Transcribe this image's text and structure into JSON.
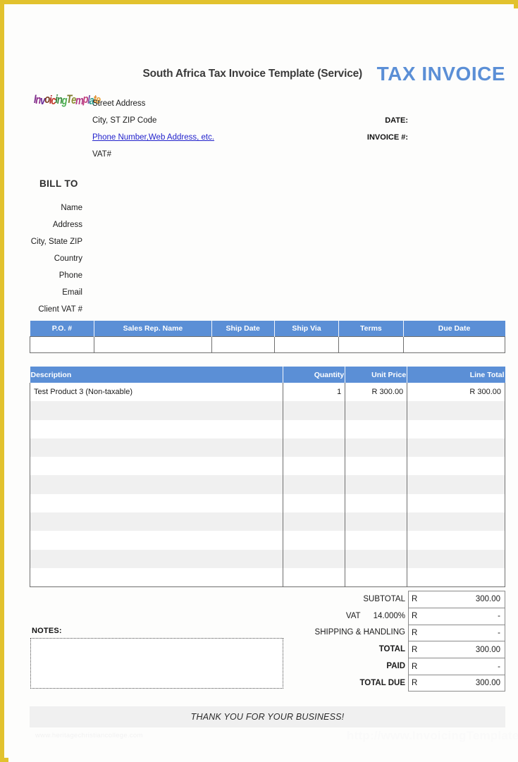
{
  "page": {
    "border_color": "#e2c22e",
    "accent_color": "#5b8fd6",
    "title": "South Africa Tax Invoice Template (Service)",
    "doc_type": "TAX INVOICE"
  },
  "logo": {
    "text": "InvoicingTemplate",
    "letters": [
      {
        "ch": "I",
        "color": "#7b2d8b"
      },
      {
        "ch": "n",
        "color": "#8e2d8b"
      },
      {
        "ch": "v",
        "color": "#6b2e9a"
      },
      {
        "ch": "o",
        "color": "#7a3d1f"
      },
      {
        "ch": "i",
        "color": "#b3262c"
      },
      {
        "ch": "c",
        "color": "#c43a2a"
      },
      {
        "ch": "i",
        "color": "#2e7d32"
      },
      {
        "ch": "n",
        "color": "#3c8c3f"
      },
      {
        "ch": "g",
        "color": "#4caf50"
      },
      {
        "ch": "T",
        "color": "#7e7a2e"
      },
      {
        "ch": "e",
        "color": "#8c8f33"
      },
      {
        "ch": "m",
        "color": "#b23a86"
      },
      {
        "ch": "p",
        "color": "#c2417f"
      },
      {
        "ch": "l",
        "color": "#7b4fa8"
      },
      {
        "ch": "a",
        "color": "#2f9e8f"
      },
      {
        "ch": "t",
        "color": "#e08b2a"
      },
      {
        "ch": "e",
        "color": "#e8a23a"
      }
    ]
  },
  "company": {
    "street": "Street Address",
    "city_line": "City, ST  ZIP Code",
    "contact_link": "Phone Number,Web Address, etc.",
    "vat": "VAT#"
  },
  "meta": {
    "date_label": "DATE:",
    "invoice_no_label": "INVOICE #:",
    "date_value": "",
    "invoice_no_value": ""
  },
  "bill_to": {
    "title": "BILL TO",
    "fields": [
      "Name",
      "Address",
      "City, State ZIP",
      "Country",
      "Phone",
      "Email",
      "Client VAT #"
    ]
  },
  "info_table": {
    "headers": [
      "P.O. #",
      "Sales Rep. Name",
      "Ship Date",
      "Ship Via",
      "Terms",
      "Due Date"
    ],
    "row": [
      "",
      "",
      "",
      "",
      "",
      ""
    ]
  },
  "items_table": {
    "headers": [
      "Description",
      "Quantity",
      "Unit Price",
      "Line Total"
    ],
    "rows": [
      {
        "description": "Test Product 3 (Non-taxable)",
        "quantity": "1",
        "unit_price": "R 300.00",
        "line_total": "R 300.00"
      },
      {
        "description": "",
        "quantity": "",
        "unit_price": "",
        "line_total": ""
      },
      {
        "description": "",
        "quantity": "",
        "unit_price": "",
        "line_total": ""
      },
      {
        "description": "",
        "quantity": "",
        "unit_price": "",
        "line_total": ""
      },
      {
        "description": "",
        "quantity": "",
        "unit_price": "",
        "line_total": ""
      },
      {
        "description": "",
        "quantity": "",
        "unit_price": "",
        "line_total": ""
      },
      {
        "description": "",
        "quantity": "",
        "unit_price": "",
        "line_total": ""
      },
      {
        "description": "",
        "quantity": "",
        "unit_price": "",
        "line_total": ""
      },
      {
        "description": "",
        "quantity": "",
        "unit_price": "",
        "line_total": ""
      },
      {
        "description": "",
        "quantity": "",
        "unit_price": "",
        "line_total": ""
      },
      {
        "description": "",
        "quantity": "",
        "unit_price": "",
        "line_total": ""
      }
    ]
  },
  "totals": {
    "currency": "R",
    "rows": [
      {
        "label": "SUBTOTAL",
        "rate": "",
        "amount": "300.00",
        "bold": false
      },
      {
        "label": "VAT",
        "rate": "14.000%",
        "amount": "-",
        "bold": false
      },
      {
        "label": "SHIPPING & HANDLING",
        "rate": "",
        "amount": "-",
        "bold": false
      },
      {
        "label": "TOTAL",
        "rate": "",
        "amount": "300.00",
        "bold": true
      },
      {
        "label": "PAID",
        "rate": "",
        "amount": "-",
        "bold": true
      },
      {
        "label": "TOTAL DUE",
        "rate": "",
        "amount": "300.00",
        "bold": true
      }
    ]
  },
  "notes": {
    "label": "NOTES:",
    "value": ""
  },
  "footer": {
    "thanks": "THANK YOU FOR YOUR BUSINESS!",
    "watermark_left": "www.heritagechristiancollege.com",
    "watermark_right": "http://www.InvoicingTemplate.com"
  }
}
